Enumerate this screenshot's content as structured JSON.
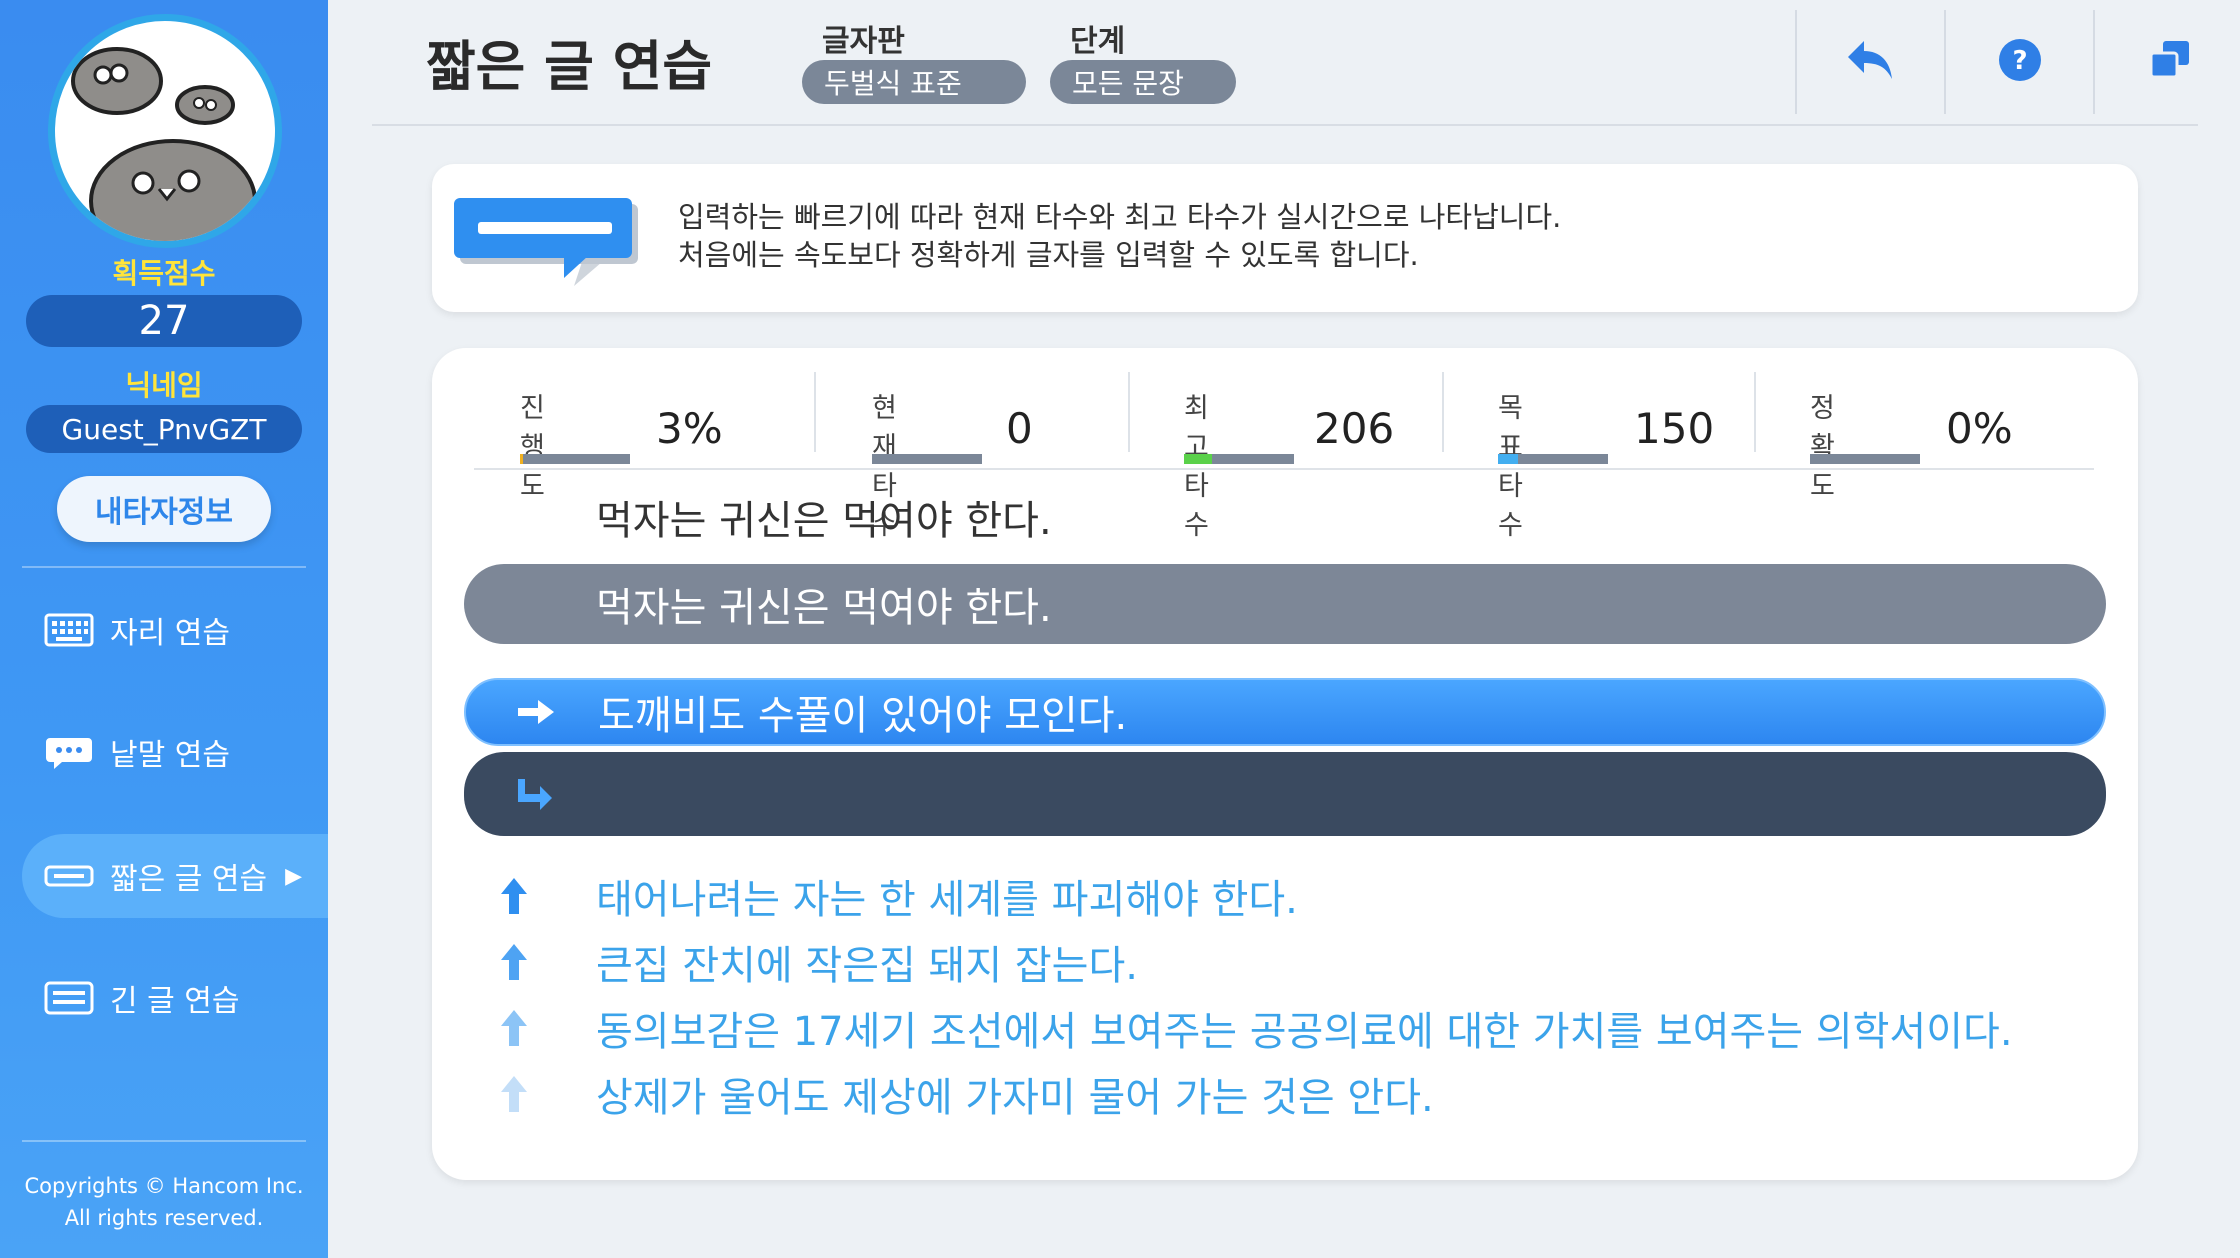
{
  "sidebar": {
    "score_label": "획득점수",
    "score": "27",
    "nickname_label": "닉네임",
    "nickname": "Guest_PnvGZT",
    "my_info_button": "내타자정보",
    "nav": [
      {
        "label": "자리 연습",
        "icon": "keyboard-icon"
      },
      {
        "label": "낱말 연습",
        "icon": "speech-bubble-icon"
      },
      {
        "label": "짧은 글 연습",
        "icon": "short-text-icon",
        "active": true
      },
      {
        "label": "긴 글 연습",
        "icon": "long-text-icon"
      }
    ],
    "copyright_line1": "Copyrights © Hancom Inc.",
    "copyright_line2": "All rights reserved."
  },
  "header": {
    "title": "짧은 글 연습",
    "keyboard_label": "글자판",
    "keyboard_value": "두벌식 표준",
    "level_label": "단계",
    "level_value": "모든 문장",
    "icons": [
      "back-icon",
      "help-icon",
      "window-icon"
    ]
  },
  "info": {
    "line1": "입력하는 빠르기에 따라 현재 타수와 최고 타수가 실시간으로 나타납니다.",
    "line2": "처음에는 속도보다 정확하게 글자를 입력할 수 있도록 합니다."
  },
  "stats": {
    "progress_label": "진행도",
    "progress_value": "3%",
    "progress_fraction": 0.03,
    "current_label": "현재 타수",
    "current_value": "0",
    "current_fraction": 0,
    "best_label": "최고 타수",
    "best_value": "206",
    "best_fraction": 0.25,
    "goal_label": "목표 타수",
    "goal_value": "150",
    "goal_fraction": 0.18,
    "accuracy_label": "정확도",
    "accuracy_value": "0%",
    "accuracy_fraction": 0
  },
  "practice": {
    "previous_sentence": "먹자는 귀신은 먹여야 한다.",
    "previous_typed": "먹자는 귀신은 먹여야 한다.",
    "current_sentence": "도깨비도 수풀이 있어야 모인다.",
    "input_value": "",
    "upcoming": [
      "태어나려는 자는 한 세계를 파괴해야 한다.",
      "큰집 잔치에 작은집 돼지 잡는다.",
      "동의보감은 17세기 조선에서 보여주는 공공의료에 대한 가치를 보여주는 의학서이다.",
      "상제가 울어도 제상에 가자미 물어 가는 것은 안다."
    ]
  },
  "colors": {
    "sidebar": "#3a8cf0",
    "accent": "#2d86f0",
    "typed_row": "#7d8797",
    "input_row": "#3a4a60",
    "upcoming_text": "#3ba3ea",
    "best_fill": "#5ad14a",
    "goal_fill": "#42aef0",
    "progress_fill": "#f0b020"
  }
}
